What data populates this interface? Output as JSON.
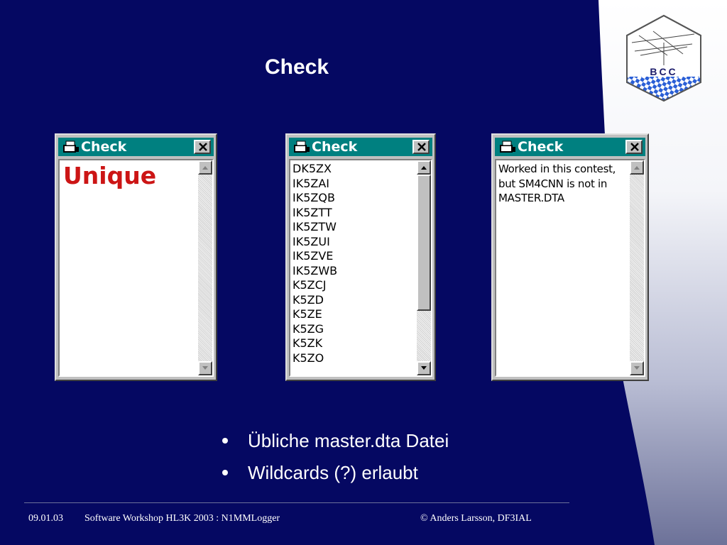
{
  "slide": {
    "title": "Check",
    "bullets": [
      "Übliche master.dta Datei",
      "Wildcards (?) erlaubt"
    ]
  },
  "logo": {
    "text": "BCC"
  },
  "windows": [
    {
      "title": "Check",
      "content_type": "unique",
      "text": "Unique"
    },
    {
      "title": "Check",
      "content_type": "list",
      "items": [
        "DK5ZX",
        "IK5ZAI",
        "IK5ZQB",
        "IK5ZTT",
        "IK5ZTW",
        "IK5ZUI",
        "IK5ZVE",
        "IK5ZWB",
        "K5ZCJ",
        "K5ZD",
        "K5ZE",
        "K5ZG",
        "K5ZK",
        "K5ZO"
      ]
    },
    {
      "title": "Check",
      "content_type": "message",
      "text": "Worked in this contest, but SM4CNN is not in MASTER.DTA"
    }
  ],
  "footer": {
    "date": "09.01.03",
    "event": "Software Workshop HL3K 2003 : N1MMLogger",
    "author": "© Anders Larsson, DF3IAL"
  },
  "colors": {
    "background": "#050862",
    "titlebar": "#008080",
    "unique_text": "#cc1515",
    "window_face": "#c0c0c0"
  }
}
